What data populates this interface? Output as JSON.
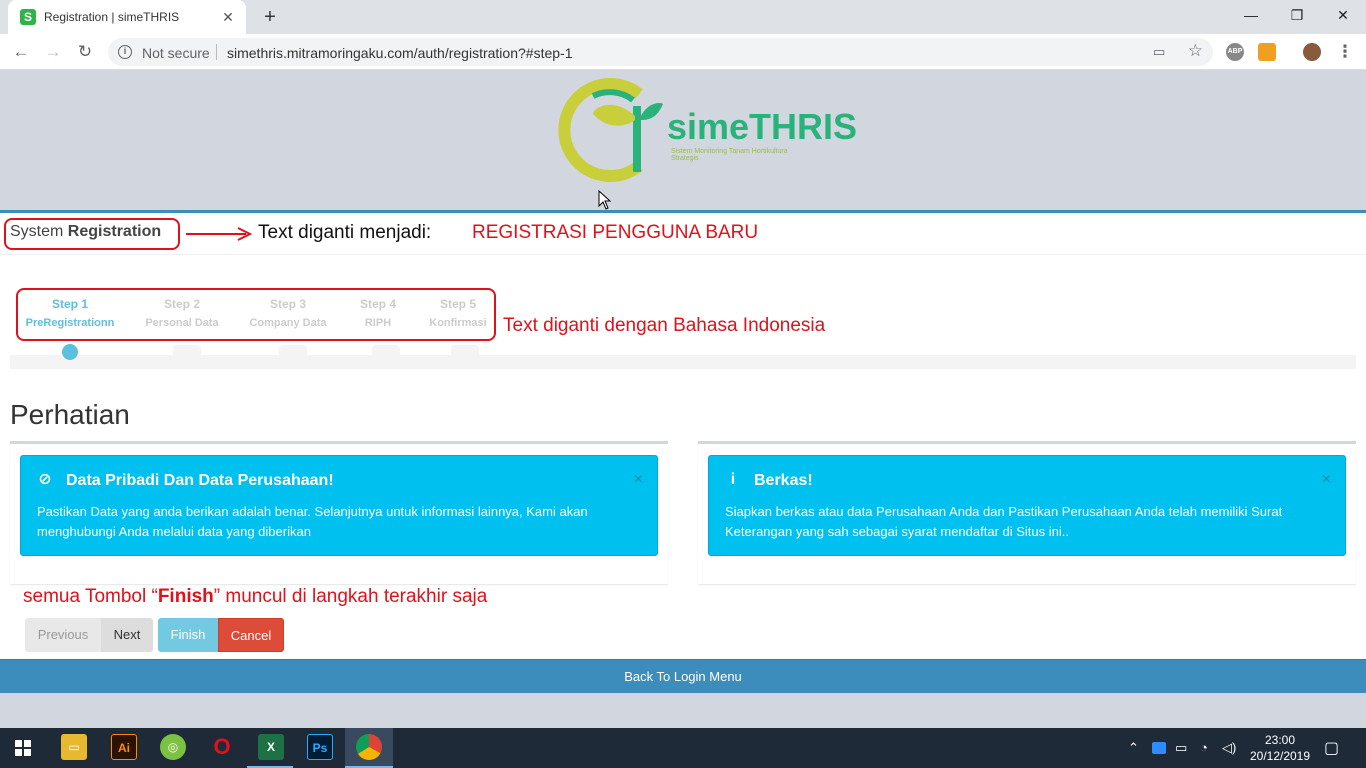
{
  "browser": {
    "tab_title": "Registration | simeTHRIS",
    "favicon_letter": "S",
    "security_label": "Not secure",
    "url": "simethris.mitramoringaku.com/auth/registration?#step-1",
    "extensions": {
      "abp": "ABP"
    }
  },
  "logo": {
    "name": "simeTHRIS",
    "tagline": "Sistem Monitoring Tanam Hortikultura Strategis"
  },
  "page": {
    "title_prefix": "System",
    "title_bold": "Registration",
    "heading": "Perhatian",
    "steps": [
      {
        "num": "Step 1",
        "desc": "PreRegistrationn",
        "active": true
      },
      {
        "num": "Step 2",
        "desc": "Personal Data",
        "active": false
      },
      {
        "num": "Step 3",
        "desc": "Company Data",
        "active": false
      },
      {
        "num": "Step 4",
        "desc": "RIPH",
        "active": false
      },
      {
        "num": "Step 5",
        "desc": "Konfirmasi",
        "active": false
      }
    ],
    "alerts": [
      {
        "title": "Data Pribadi Dan Data Perusahaan!",
        "body": "Pastikan Data yang anda berikan adalah benar. Selanjutnya untuk informasi lainnya, Kami akan menghubungi Anda melalui data yang diberikan",
        "icon": "ban-icon"
      },
      {
        "title": "Berkas!",
        "body": "Siapkan berkas atau data Perusahaan Anda dan Pastikan Perusahaan Anda telah memiliki Surat Keterangan yang sah sebagai syarat mendaftar di Situs ini..",
        "icon": "info-icon"
      }
    ],
    "close_symbol": "×",
    "buttons": {
      "previous": "Previous",
      "next": "Next",
      "finish": "Finish",
      "cancel": "Cancel"
    },
    "footer_link": "Back To Login Menu"
  },
  "annotations": {
    "replace_label": "Text diganti menjadi:",
    "replace_value": "REGISTRASI PENGGUNA BARU",
    "steps_note": "Text diganti dengan Bahasa Indonesia",
    "finish_note_pre": "semua Tombol “",
    "finish_note_bold": "Finish",
    "finish_note_post": "” muncul di langkah terakhir saja"
  },
  "taskbar": {
    "time": "23:00",
    "date": "20/12/2019",
    "apps": [
      "file-explorer",
      "illustrator",
      "app-green",
      "opera",
      "excel",
      "photoshop",
      "chrome"
    ],
    "illustrator_label": "Ai",
    "photoshop_label": "Ps",
    "excel_label": "X"
  },
  "colors": {
    "primary": "#3c8dbc",
    "info": "#00c0ef",
    "danger": "#dd4b39",
    "annotation": "#e0111c",
    "step_active": "#5bc0de"
  }
}
